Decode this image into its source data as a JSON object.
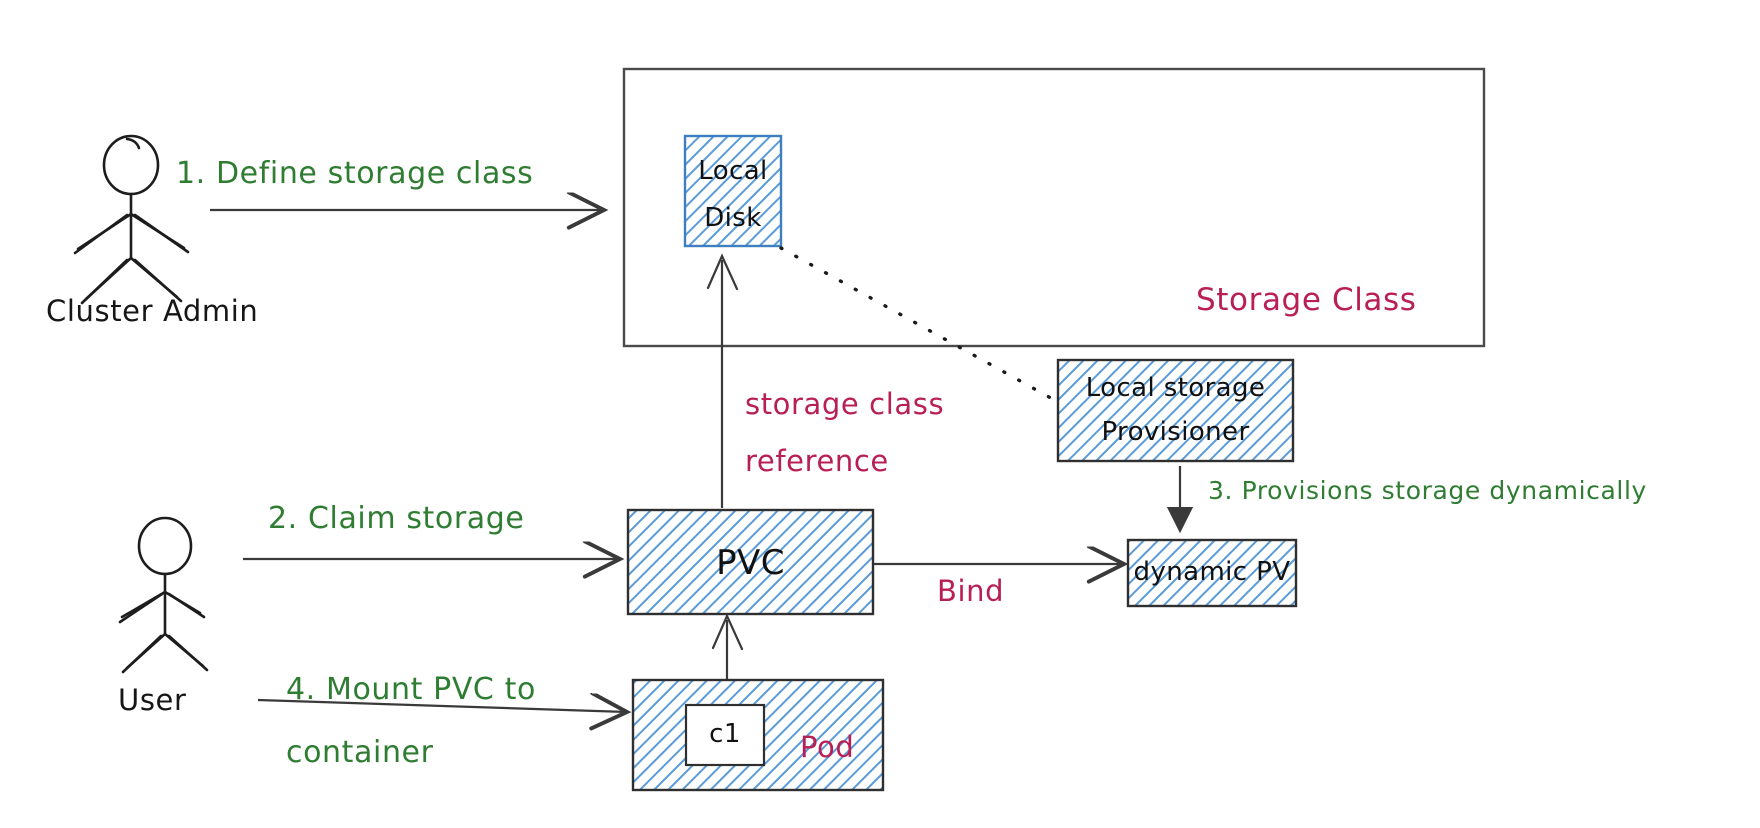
{
  "diagram": {
    "title": "Kubernetes dynamic storage provisioning (hand-drawn)",
    "colors": {
      "green": "#2f7d32",
      "crimson": "#b81f55",
      "black": "#161616",
      "hatch_blue": "#5a9bd8",
      "box_border": "#3a3a3a",
      "line": "#444444"
    }
  },
  "actors": [
    {
      "id": "cluster-admin",
      "label": "Cluster Admin"
    },
    {
      "id": "user",
      "label": "User"
    }
  ],
  "containers": {
    "storage_class": {
      "label": "Storage Class"
    }
  },
  "boxes": [
    {
      "id": "local-disk",
      "line1": "Local",
      "line2": "Disk"
    },
    {
      "id": "local-storage-provisioner",
      "line1": "Local storage",
      "line2": "Provisioner"
    },
    {
      "id": "dynamic-pv",
      "line1": "dynamic PV"
    },
    {
      "id": "pvc",
      "line1": "PVC"
    },
    {
      "id": "pod",
      "line1": "Pod"
    },
    {
      "id": "container",
      "line1": "c1"
    }
  ],
  "steps": [
    {
      "num": "1",
      "text": "1. Define storage class"
    },
    {
      "num": "2",
      "text": "2. Claim storage"
    },
    {
      "num": "3",
      "text": "3. Provisions storage dynamically"
    },
    {
      "num": "4",
      "line1": "4. Mount PVC to",
      "line2": "container"
    }
  ],
  "edge_labels": [
    {
      "id": "storage-class-reference",
      "line1": "storage class",
      "line2": "reference"
    },
    {
      "id": "bind",
      "text": "Bind"
    }
  ]
}
